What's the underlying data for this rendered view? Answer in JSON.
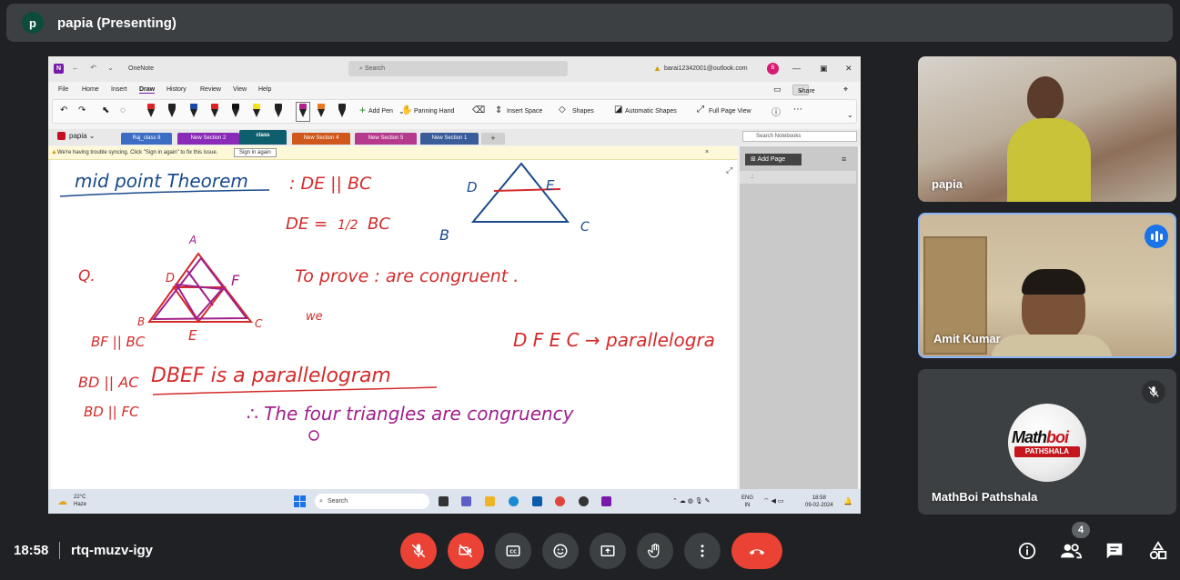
{
  "presenter_bar": {
    "avatar_letter": "p",
    "title": "papia (Presenting)"
  },
  "onenote": {
    "app_title": "OneNote",
    "search_placeholder": "Search",
    "account": "barai12342001@outlook.com",
    "account_initial": "B",
    "menu": [
      "File",
      "Home",
      "Insert",
      "Draw",
      "History",
      "Review",
      "View",
      "Help"
    ],
    "share_label": "Share",
    "ribbon": {
      "add_pen": "Add Pen",
      "panning_hand": "Panning Hand",
      "insert_space": "Insert Space",
      "shapes": "Shapes",
      "automatic_shapes": "Automatic Shapes",
      "full_page_view": "Full Page View"
    },
    "notebook": "papia",
    "sections": [
      {
        "label": "Raj_class 8",
        "color": "#3d6cc4"
      },
      {
        "label": "New Section 2",
        "color": "#8a2bb8"
      },
      {
        "label": "class",
        "color": "#0e5f6e"
      },
      {
        "label": "New Section 4",
        "color": "#d0581c"
      },
      {
        "label": "New Section 5",
        "color": "#b53a8e"
      },
      {
        "label": "New Section 1",
        "color": "#3b5c9a"
      }
    ],
    "add_section": "+",
    "search_notebooks": "Search Notebooks",
    "info_message": "We're having trouble syncing. Click \"Sign in again\" to fix this issue.",
    "sign_in_button": "Sign in again",
    "add_page": "Add Page",
    "page_title_stub": ".:",
    "handwriting": {
      "title": "mid point  Theorem",
      "line1": ": DE || BC",
      "line2": "DE =",
      "line2_fraction": "1/2",
      "line2_end": "BC",
      "triangle_labels": {
        "A": "A",
        "B": "B",
        "C": "C",
        "D": "D",
        "E": "E",
        "F": "F"
      },
      "q": "Q.",
      "to_prove": "To prove  :  are  congruent .",
      "we": "we",
      "bf_bc": "BF || BC",
      "bd_ac": "BD || AC",
      "bd_fc": "BD || FC",
      "dbef": "DBEF  is  a  parallelogram",
      "dfec": "D F E C  →  parallelogra",
      "four": "∴  The  four  triangles  are  congruency"
    }
  },
  "taskbar": {
    "temp": "22°C",
    "weather": "Haze",
    "search": "Search",
    "lang1": "ENG",
    "lang2": "IN",
    "time": "18:58",
    "date": "09-02-2024"
  },
  "participants": [
    {
      "name": "papia"
    },
    {
      "name": "Amit Kumar"
    },
    {
      "name": "MathBoi Pathshala",
      "logo_line1": "Math",
      "logo_line1b": "boi",
      "logo_line2": "PATHSHALA"
    }
  ],
  "controls": {
    "time": "18:58",
    "meeting_code": "rtq-muzv-igy",
    "participant_count": "4"
  },
  "colors": {
    "accent_red": "#ea4335",
    "accent_blue": "#1a73e8",
    "bar_bg": "#3c4043",
    "onenote_purple": "#7719aa"
  }
}
